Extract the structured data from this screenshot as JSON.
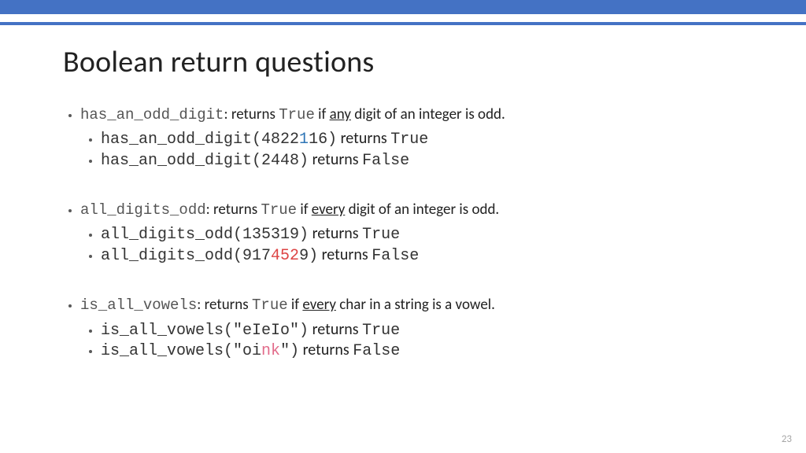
{
  "title": "Boolean return questions",
  "page_number": "23",
  "items": [
    {
      "fn": "has_an_odd_digit",
      "desc_before": ": returns ",
      "desc_code": "True",
      "desc_mid": " if ",
      "desc_qword": "any",
      "desc_after": " digit of an integer is odd.",
      "examples": [
        {
          "pre": "has_an_odd_digit(4822",
          "hl": "1",
          "hl_class": "hl-blue",
          "post": "16)",
          "ret_word": " returns ",
          "ret_val": "True"
        },
        {
          "pre": "has_an_odd_digit(2448)",
          "hl": "",
          "hl_class": "",
          "post": "",
          "ret_word": " returns ",
          "ret_val": "False"
        }
      ]
    },
    {
      "fn": "all_digits_odd",
      "desc_before": ": returns ",
      "desc_code": "True",
      "desc_mid": " if ",
      "desc_qword": "every",
      "desc_after": " digit of an integer is odd.",
      "examples": [
        {
          "pre": "all_digits_odd(135319)",
          "hl": "",
          "hl_class": "",
          "post": "",
          "ret_word": " returns ",
          "ret_val": "True"
        },
        {
          "pre": "all_digits_odd(917",
          "hl": "452",
          "hl_class": "hl-red",
          "post": "9)",
          "ret_word": " returns ",
          "ret_val": "False"
        }
      ]
    },
    {
      "fn": "is_all_vowels",
      "desc_before": ": returns ",
      "desc_code": "True",
      "desc_mid": " if ",
      "desc_qword": "every",
      "desc_after": " char in a string is a vowel.",
      "examples": [
        {
          "pre": "is_all_vowels(\"eIeIo\")",
          "hl": "",
          "hl_class": "",
          "post": "",
          "ret_word": " returns ",
          "ret_val": "True"
        },
        {
          "pre": "is_all_vowels(\"oi",
          "hl": "nk",
          "hl_class": "hl-pink",
          "post": "\")",
          "ret_word": " returns ",
          "ret_val": "False"
        }
      ]
    }
  ]
}
